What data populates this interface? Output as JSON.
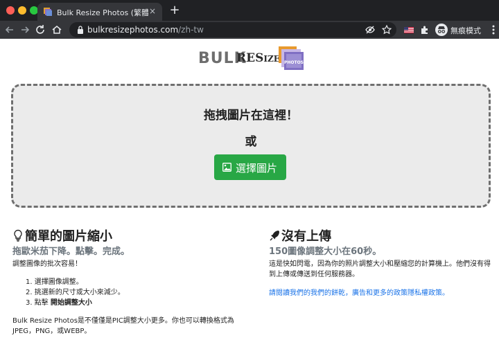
{
  "browser": {
    "tab_title": "Bulk Resize Photos (繁體中文)",
    "tab_close": "×",
    "new_tab": "+",
    "url_host": "bulkresizephotos.com",
    "url_path": "/zh-tw",
    "incognito_label": "無痕模式"
  },
  "logo": {
    "bulk": "BULK",
    "resize_a": "RES",
    "resize_b": "IZE",
    "photos": "PHOTOS"
  },
  "dropzone": {
    "title": "拖拽圖片在這裡！",
    "or": "或",
    "button_label": "選擇圖片"
  },
  "left": {
    "heading": "簡單的圖片縮小",
    "subheading": "拖歐米茄下降。點擊。完成。",
    "intro": "調整圖像的批次容易！",
    "steps": [
      {
        "num": "1.",
        "text": "選擇圖像調整。"
      },
      {
        "num": "2.",
        "text": "挑選新的尺寸或大小來減少。"
      },
      {
        "num": "3.",
        "text": "點擊",
        "bold": "開始調整大小"
      }
    ],
    "footer": "Bulk Resize Photos是不僅僅是PIC調整大小更多。你也可以轉換格式為JPEG，PNG，或WEBP。"
  },
  "right": {
    "heading": "沒有上傳",
    "subheading": "150圖像調整大小在60秒。",
    "paragraph": "這是快如閃電，因為你的照片調整大小和壓縮您的計算機上。他們沒有得到上傳或傳送到任何服務器。",
    "link": "請閱讀我們的我們的餅乾，廣告和更多的政策隱私權政策。"
  },
  "colors": {
    "accent_green": "#28a745",
    "link_blue": "#1a73e8",
    "muted_gray": "#6c757d"
  }
}
